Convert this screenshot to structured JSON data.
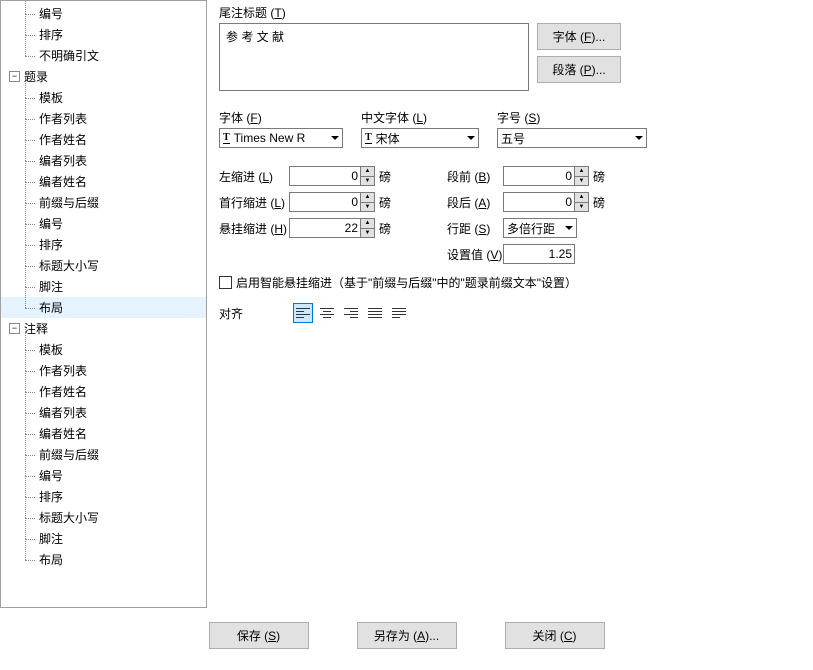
{
  "sidebar": {
    "groups": [
      {
        "items": [
          "编号",
          "排序",
          "不明确引文"
        ]
      },
      {
        "label": "题录",
        "items": [
          "模板",
          "作者列表",
          "作者姓名",
          "编者列表",
          "编者姓名",
          "前缀与后缀",
          "编号",
          "排序",
          "标题大小写",
          "脚注",
          "布局"
        ],
        "selected": 10
      },
      {
        "label": "注释",
        "items": [
          "模板",
          "作者列表",
          "作者姓名",
          "编者列表",
          "编者姓名",
          "前缀与后缀",
          "编号",
          "排序",
          "标题大小写",
          "脚注",
          "布局"
        ]
      }
    ]
  },
  "main": {
    "title_label_pre": "尾注标题 (",
    "title_label_key": "T",
    "title_label_post": ")",
    "title_value": "参 考 文 献",
    "font_btn_pre": "字体 (",
    "font_btn_key": "F",
    "font_btn_post": ")...",
    "para_btn_pre": "段落 (",
    "para_btn_key": "P",
    "para_btn_post": ")...",
    "font_label_pre": "字体 (",
    "font_label_key": "F",
    "font_label_post": ")",
    "font_value": "Times New R",
    "cfont_label_pre": "中文字体 (",
    "cfont_label_key": "L",
    "cfont_label_post": ")",
    "cfont_value": "宋体",
    "size_label_pre": "字号 (",
    "size_label_key": "S",
    "size_label_post": ")",
    "size_value": "五号",
    "left_indent_pre": "左缩进 (",
    "left_indent_key": "L",
    "left_indent_post": ")",
    "left_indent_val": "0",
    "first_indent_pre": "首行缩进 (",
    "first_indent_key": "L",
    "first_indent_post": ")",
    "first_indent_val": "0",
    "hang_indent_pre": "悬挂缩进 (",
    "hang_indent_key": "H",
    "hang_indent_post": ")",
    "hang_indent_val": "22",
    "before_pre": "段前 (",
    "before_key": "B",
    "before_post": ")",
    "before_val": "0",
    "after_pre": "段后 (",
    "after_key": "A",
    "after_post": ")",
    "after_val": "0",
    "spacing_pre": "行距 (",
    "spacing_key": "S",
    "spacing_post": ")",
    "spacing_val": "多倍行距",
    "setval_pre": "设置值 (",
    "setval_key": "V",
    "setval_post": ")",
    "setval_val": "1.25",
    "unit_pound": "磅",
    "check_label": "启用智能悬挂缩进（基于\"前缀与后缀\"中的\"题录前缀文本\"设置）",
    "align_label": "对齐"
  },
  "footer": {
    "save_pre": "保存 (",
    "save_key": "S",
    "save_post": ")",
    "saveas_pre": "另存为 (",
    "saveas_key": "A",
    "saveas_post": ")...",
    "close_pre": "关闭 (",
    "close_key": "C",
    "close_post": ")"
  }
}
